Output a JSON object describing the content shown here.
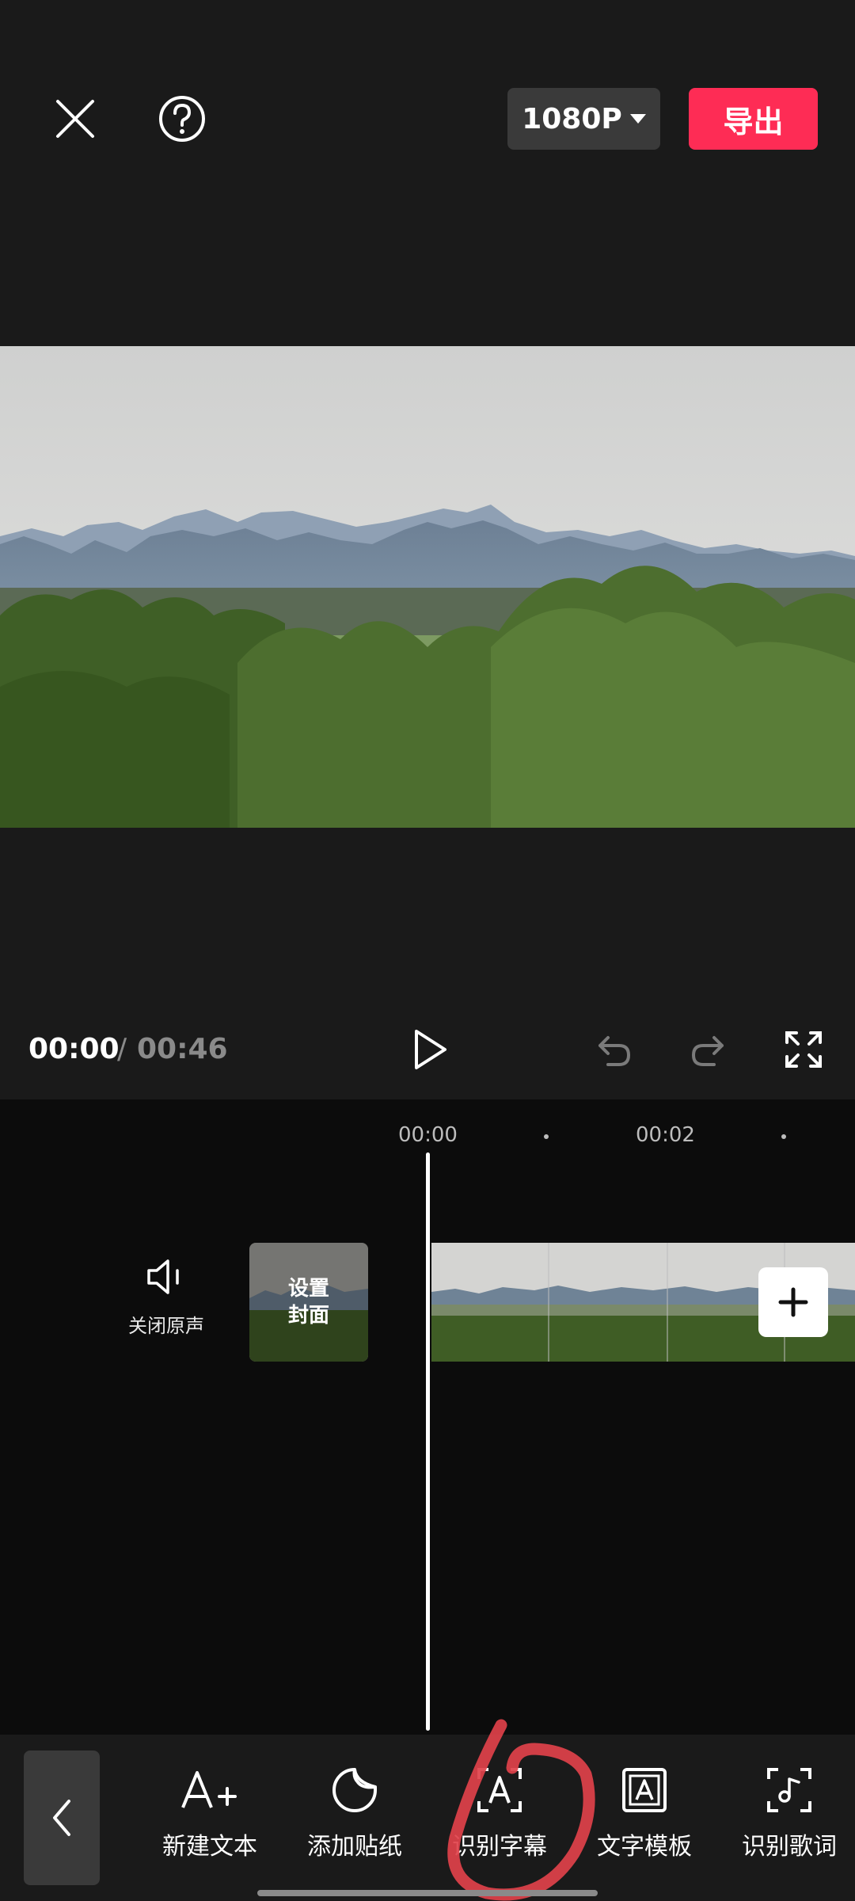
{
  "header": {
    "resolution_label": "1080P",
    "export_label": "导出"
  },
  "player": {
    "current_time": "00:00",
    "separator": "/",
    "total_time": "00:46"
  },
  "timeline": {
    "ticks": [
      "00:00",
      "00:02"
    ],
    "mute_label": "关闭原声",
    "cover_label_line1": "设置",
    "cover_label_line2": "封面"
  },
  "toolbar": {
    "items": [
      {
        "label": "新建文本",
        "icon": "add-text-icon"
      },
      {
        "label": "添加贴纸",
        "icon": "sticker-icon"
      },
      {
        "label": "识别字幕",
        "icon": "caption-recognize-icon"
      },
      {
        "label": "文字模板",
        "icon": "text-template-icon"
      },
      {
        "label": "识别歌词",
        "icon": "lyrics-recognize-icon"
      }
    ]
  },
  "colors": {
    "accent": "#fe2c55",
    "background": "#1a1a1a",
    "annotation": "#e0414a"
  }
}
